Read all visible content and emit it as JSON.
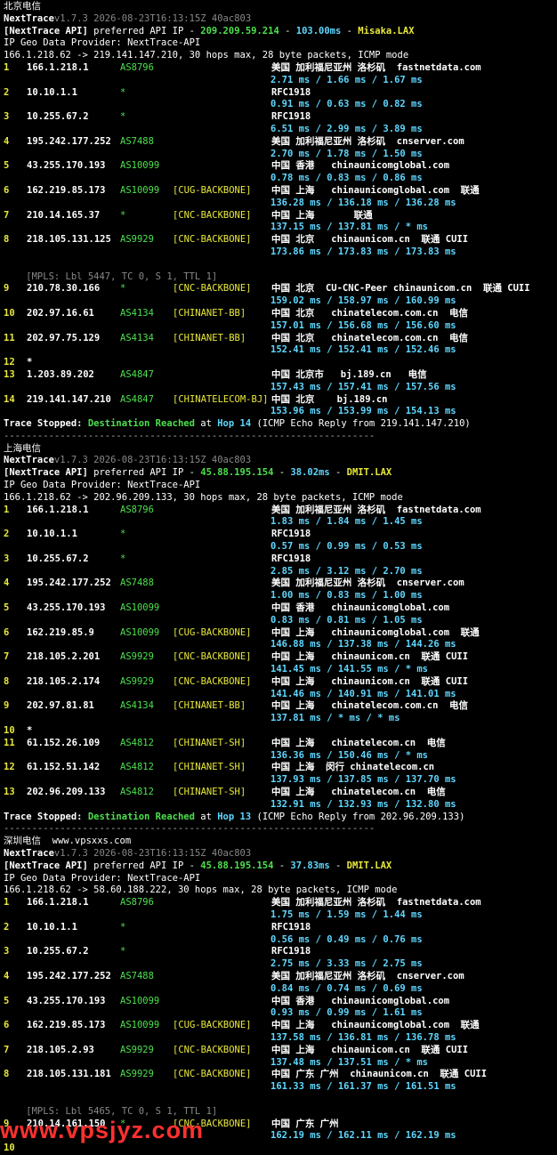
{
  "sections": [
    {
      "title": "北京电信",
      "title_extra": "",
      "header": {
        "app": "NextTrace",
        "version": "v1.7.3 2026-08-23T16:13:15Z 40ac803",
        "api_tag": "[NextTrace API]",
        "api_text": " preferred API IP - ",
        "api_ip": "209.209.59.214",
        "api_sep1": " - ",
        "api_ms": "103.00ms",
        "api_sep2": " - ",
        "api_loc": "Misaka.LAX"
      },
      "provider": "IP Geo Data Provider: NextTrace-API",
      "route": "166.1.218.62 -> 219.141.147.210, 30 hops max, 28 byte packets, ICMP mode",
      "lines": [
        {
          "t": "hop",
          "n": "1",
          "ip": "166.1.218.1",
          "as": "AS8796",
          "tag": "",
          "geo": "美国 加利福尼亚州 洛杉矶  fastnetdata.com"
        },
        {
          "t": "rtt",
          "v": "2.71 ms / 1.66 ms / 1.67 ms"
        },
        {
          "t": "hop",
          "n": "2",
          "ip": "10.10.1.1",
          "as": "*",
          "tag": "",
          "geo": "RFC1918"
        },
        {
          "t": "rtt",
          "v": "0.91 ms / 0.63 ms / 0.82 ms"
        },
        {
          "t": "hop",
          "n": "3",
          "ip": "10.255.67.2",
          "as": "*",
          "tag": "",
          "geo": "RFC1918"
        },
        {
          "t": "rtt",
          "v": "6.51 ms / 2.99 ms / 3.89 ms"
        },
        {
          "t": "hop",
          "n": "4",
          "ip": "195.242.177.252",
          "as": "AS7488",
          "tag": "",
          "geo": "美国 加利福尼亚州 洛杉矶  cnserver.com"
        },
        {
          "t": "rtt",
          "v": "2.70 ms / 1.78 ms / 1.50 ms"
        },
        {
          "t": "hop",
          "n": "5",
          "ip": "43.255.170.193",
          "as": "AS10099",
          "tag": "",
          "geo": "中国 香港   chinaunicomglobal.com"
        },
        {
          "t": "rtt",
          "v": "0.78 ms / 0.83 ms / 0.86 ms"
        },
        {
          "t": "hop",
          "n": "6",
          "ip": "162.219.85.173",
          "as": "AS10099",
          "tag": "[CUG-BACKBONE]",
          "geo": "中国 上海   chinaunicomglobal.com  联通"
        },
        {
          "t": "rtt",
          "v": "136.28 ms / 136.18 ms / 136.28 ms"
        },
        {
          "t": "hop",
          "n": "7",
          "ip": "210.14.165.37",
          "as": "*",
          "tag": "[CNC-BACKBONE]",
          "geo": "中国 上海       联通"
        },
        {
          "t": "rtt",
          "v": "137.15 ms / 137.81 ms / * ms"
        },
        {
          "t": "hop",
          "n": "8",
          "ip": "218.105.131.125",
          "as": "AS9929",
          "tag": "[CNC-BACKBONE]",
          "geo": "中国 北京   chinaunicom.cn  联通 CUII"
        },
        {
          "t": "rtt",
          "v": "173.86 ms / 173.83 ms / 173.83 ms"
        },
        {
          "t": "blank"
        },
        {
          "t": "mpls",
          "v": "    [MPLS: Lbl 5447, TC 0, S 1, TTL 1]"
        },
        {
          "t": "hop",
          "n": "9",
          "ip": "210.78.30.166",
          "as": "*",
          "tag": "[CNC-BACKBONE]",
          "geo": "中国 北京  CU-CNC-Peer chinaunicom.cn  联通 CUII"
        },
        {
          "t": "rtt",
          "v": "159.02 ms / 158.97 ms / 160.99 ms"
        },
        {
          "t": "hop",
          "n": "10",
          "ip": "202.97.16.61",
          "as": "AS4134",
          "tag": "[CHINANET-BB]",
          "geo": "中国 北京   chinatelecom.com.cn  电信"
        },
        {
          "t": "rtt",
          "v": "157.01 ms / 156.68 ms / 156.60 ms"
        },
        {
          "t": "hop",
          "n": "11",
          "ip": "202.97.75.129",
          "as": "AS4134",
          "tag": "[CHINANET-BB]",
          "geo": "中国 北京   chinatelecom.com.cn  电信"
        },
        {
          "t": "rtt",
          "v": "152.41 ms / 152.41 ms / 152.46 ms"
        },
        {
          "t": "hop",
          "n": "12",
          "ip": "*",
          "as": "",
          "tag": "",
          "geo": ""
        },
        {
          "t": "hop",
          "n": "13",
          "ip": "1.203.89.202",
          "as": "AS4847",
          "tag": "",
          "geo": "中国 北京市   bj.189.cn   电信"
        },
        {
          "t": "rtt",
          "v": "157.43 ms / 157.41 ms / 157.56 ms"
        },
        {
          "t": "hop",
          "n": "14",
          "ip": "219.141.147.210",
          "as": "AS4847",
          "tag": "[CHINATELECOM-BJ]",
          "geo": "中国 北京    bj.189.cn"
        },
        {
          "t": "rtt",
          "v": "153.96 ms / 153.99 ms / 154.13 ms"
        }
      ],
      "stop": {
        "a": "Trace Stopped: ",
        "b": "Destination Reached",
        "c": " at ",
        "d": "Hop 14",
        "e": " (ICMP Echo Reply from 219.141.147.210)"
      },
      "sep": "------------------------------------------------------------------"
    },
    {
      "title": "上海电信",
      "title_extra": "",
      "header": {
        "app": "NextTrace",
        "version": "v1.7.3 2026-08-23T16:13:15Z 40ac803",
        "api_tag": "[NextTrace API]",
        "api_text": " preferred API IP - ",
        "api_ip": "45.88.195.154",
        "api_sep1": " - ",
        "api_ms": "38.02ms",
        "api_sep2": " - ",
        "api_loc": "DMIT.LAX"
      },
      "provider": "IP Geo Data Provider: NextTrace-API",
      "route": "166.1.218.62 -> 202.96.209.133, 30 hops max, 28 byte packets, ICMP mode",
      "lines": [
        {
          "t": "hop",
          "n": "1",
          "ip": "166.1.218.1",
          "as": "AS8796",
          "tag": "",
          "geo": "美国 加利福尼亚州 洛杉矶  fastnetdata.com"
        },
        {
          "t": "rtt",
          "v": "1.83 ms / 1.84 ms / 1.45 ms"
        },
        {
          "t": "hop",
          "n": "2",
          "ip": "10.10.1.1",
          "as": "*",
          "tag": "",
          "geo": "RFC1918"
        },
        {
          "t": "rtt",
          "v": "0.57 ms / 0.99 ms / 0.53 ms"
        },
        {
          "t": "hop",
          "n": "3",
          "ip": "10.255.67.2",
          "as": "*",
          "tag": "",
          "geo": "RFC1918"
        },
        {
          "t": "rtt",
          "v": "2.85 ms / 3.12 ms / 2.70 ms"
        },
        {
          "t": "hop",
          "n": "4",
          "ip": "195.242.177.252",
          "as": "AS7488",
          "tag": "",
          "geo": "美国 加利福尼亚州 洛杉矶  cnserver.com"
        },
        {
          "t": "rtt",
          "v": "1.00 ms / 0.83 ms / 1.00 ms"
        },
        {
          "t": "hop",
          "n": "5",
          "ip": "43.255.170.193",
          "as": "AS10099",
          "tag": "",
          "geo": "中国 香港   chinaunicomglobal.com"
        },
        {
          "t": "rtt",
          "v": "0.83 ms / 0.81 ms / 1.05 ms"
        },
        {
          "t": "hop",
          "n": "6",
          "ip": "162.219.85.9",
          "as": "AS10099",
          "tag": "[CUG-BACKBONE]",
          "geo": "中国 上海   chinaunicomglobal.com  联通"
        },
        {
          "t": "rtt",
          "v": "146.88 ms / 137.38 ms / 144.26 ms"
        },
        {
          "t": "hop",
          "n": "7",
          "ip": "218.105.2.201",
          "as": "AS9929",
          "tag": "[CNC-BACKBONE]",
          "geo": "中国 上海   chinaunicom.cn  联通 CUII"
        },
        {
          "t": "rtt",
          "v": "141.45 ms / 141.55 ms / * ms"
        },
        {
          "t": "hop",
          "n": "8",
          "ip": "218.105.2.174",
          "as": "AS9929",
          "tag": "[CNC-BACKBONE]",
          "geo": "中国 上海   chinaunicom.cn  联通 CUII"
        },
        {
          "t": "rtt",
          "v": "141.46 ms / 140.91 ms / 141.01 ms"
        },
        {
          "t": "hop",
          "n": "9",
          "ip": "202.97.81.81",
          "as": "AS4134",
          "tag": "[CHINANET-BB]",
          "geo": "中国 上海   chinatelecom.com.cn  电信"
        },
        {
          "t": "rtt",
          "v": "137.81 ms / * ms / * ms"
        },
        {
          "t": "hop",
          "n": "10",
          "ip": "*",
          "as": "",
          "tag": "",
          "geo": ""
        },
        {
          "t": "hop",
          "n": "11",
          "ip": "61.152.26.109",
          "as": "AS4812",
          "tag": "[CHINANET-SH]",
          "geo": "中国 上海   chinatelecom.cn  电信"
        },
        {
          "t": "rtt",
          "v": "136.36 ms / 150.46 ms / * ms"
        },
        {
          "t": "hop",
          "n": "12",
          "ip": "61.152.51.142",
          "as": "AS4812",
          "tag": "[CHINANET-SH]",
          "geo": "中国 上海  闵行 chinatelecom.cn"
        },
        {
          "t": "rtt",
          "v": "137.93 ms / 137.85 ms / 137.70 ms"
        },
        {
          "t": "hop",
          "n": "13",
          "ip": "202.96.209.133",
          "as": "AS4812",
          "tag": "[CHINANET-SH]",
          "geo": "中国 上海   chinatelecom.cn  电信"
        },
        {
          "t": "rtt",
          "v": "132.91 ms / 132.93 ms / 132.80 ms"
        }
      ],
      "stop": {
        "a": "Trace Stopped: ",
        "b": "Destination Reached",
        "c": " at ",
        "d": "Hop 13",
        "e": " (ICMP Echo Reply from 202.96.209.133)"
      },
      "sep": "------------------------------------------------------------------"
    },
    {
      "title": "深圳电信",
      "title_extra": "  www.vpsxxs.com",
      "header": {
        "app": "NextTrace",
        "version": "v1.7.3 2026-08-23T16:13:15Z 40ac803",
        "api_tag": "[NextTrace API]",
        "api_text": " preferred API IP - ",
        "api_ip": "45.88.195.154",
        "api_sep1": " - ",
        "api_ms": "37.83ms",
        "api_sep2": " - ",
        "api_loc": "DMIT.LAX"
      },
      "provider": "IP Geo Data Provider: NextTrace-API",
      "route": "166.1.218.62 -> 58.60.188.222, 30 hops max, 28 byte packets, ICMP mode",
      "lines": [
        {
          "t": "hop",
          "n": "1",
          "ip": "166.1.218.1",
          "as": "AS8796",
          "tag": "",
          "geo": "美国 加利福尼亚州 洛杉矶  fastnetdata.com"
        },
        {
          "t": "rtt",
          "v": "1.75 ms / 1.59 ms / 1.44 ms"
        },
        {
          "t": "hop",
          "n": "2",
          "ip": "10.10.1.1",
          "as": "*",
          "tag": "",
          "geo": "RFC1918"
        },
        {
          "t": "rtt",
          "v": "0.56 ms / 0.49 ms / 0.76 ms"
        },
        {
          "t": "hop",
          "n": "3",
          "ip": "10.255.67.2",
          "as": "*",
          "tag": "",
          "geo": "RFC1918"
        },
        {
          "t": "rtt",
          "v": "2.75 ms / 3.33 ms / 2.75 ms"
        },
        {
          "t": "hop",
          "n": "4",
          "ip": "195.242.177.252",
          "as": "AS7488",
          "tag": "",
          "geo": "美国 加利福尼亚州 洛杉矶  cnserver.com"
        },
        {
          "t": "rtt",
          "v": "0.84 ms / 0.74 ms / 0.69 ms"
        },
        {
          "t": "hop",
          "n": "5",
          "ip": "43.255.170.193",
          "as": "AS10099",
          "tag": "",
          "geo": "中国 香港   chinaunicomglobal.com"
        },
        {
          "t": "rtt",
          "v": "0.93 ms / 0.99 ms / 1.61 ms"
        },
        {
          "t": "hop",
          "n": "6",
          "ip": "162.219.85.173",
          "as": "AS10099",
          "tag": "[CUG-BACKBONE]",
          "geo": "中国 上海   chinaunicomglobal.com  联通"
        },
        {
          "t": "rtt",
          "v": "137.58 ms / 136.81 ms / 136.78 ms"
        },
        {
          "t": "hop",
          "n": "7",
          "ip": "218.105.2.93",
          "as": "AS9929",
          "tag": "[CNC-BACKBONE]",
          "geo": "中国 上海   chinaunicom.cn  联通 CUII"
        },
        {
          "t": "rtt",
          "v": "137.48 ms / 137.51 ms / * ms"
        },
        {
          "t": "hop",
          "n": "8",
          "ip": "218.105.131.181",
          "as": "AS9929",
          "tag": "[CNC-BACKBONE]",
          "geo": "中国 广东 广州  chinaunicom.cn  联通 CUII"
        },
        {
          "t": "rtt",
          "v": "161.33 ms / 161.37 ms / 161.51 ms"
        },
        {
          "t": "blank"
        },
        {
          "t": "mpls",
          "v": "    [MPLS: Lbl 5465, TC 0, S 1, TTL 1]"
        },
        {
          "t": "hop",
          "n": "9",
          "ip": "210.14.161.150",
          "as": "*",
          "tag": "[CNC-BACKBONE]",
          "geo": "中国 广东 广州"
        },
        {
          "t": "rtt",
          "v": "162.19 ms / 162.11 ms / 162.19 ms"
        },
        {
          "t": "hop",
          "n": "10",
          "ip": "",
          "as": "",
          "tag": "",
          "geo": ""
        }
      ],
      "stop": null,
      "sep": ""
    }
  ],
  "watermark": "www.vpsjyz.com"
}
